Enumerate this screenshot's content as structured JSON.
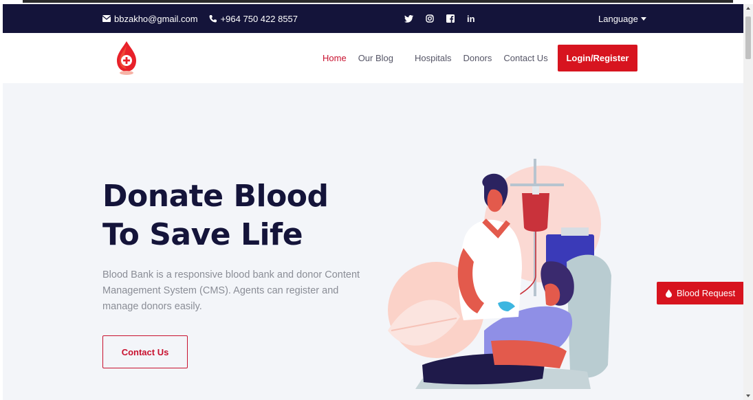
{
  "topbar": {
    "email": "bbzakho@gmail.com",
    "phone": "+964 750 422 8557",
    "social": {
      "twitter": "🐦",
      "instagram": "◎",
      "facebook": "f",
      "linkedin": "in"
    },
    "language_label": "Language"
  },
  "navbar": {
    "logo_icon": "blood-drop-plus",
    "links": [
      "Home",
      "Our Blog",
      "Hospitals",
      "Donors",
      "Contact Us"
    ],
    "login_label": "Login/Register"
  },
  "hero": {
    "title_line1": "Donate Blood",
    "title_line2": "To Save Life",
    "description": "Blood Bank is a responsive blood bank and donor Content Management System (CMS). Agents can register and manage donors easily.",
    "contact_button": "Contact Us"
  },
  "floating": {
    "blood_request_label": "Blood Request"
  },
  "colors": {
    "navy": "#14143a",
    "accent": "#d7141f",
    "hero_bg": "#f3f5f9"
  }
}
